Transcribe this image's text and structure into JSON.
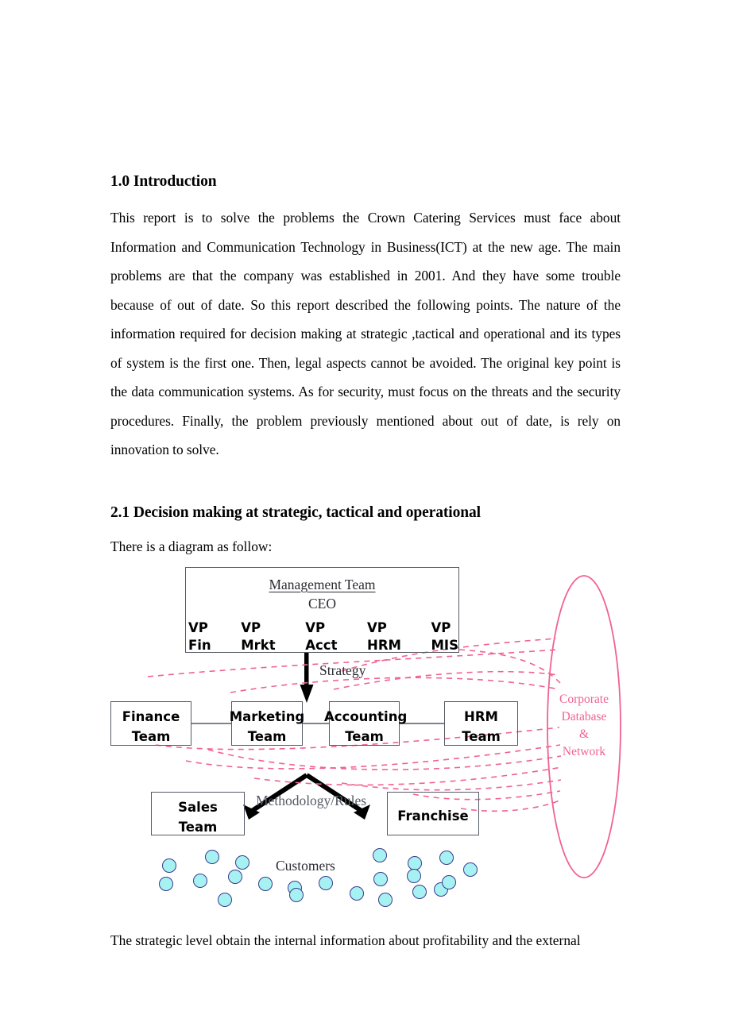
{
  "document": {
    "sections": [
      {
        "heading": "1.0 Introduction",
        "paragraph": "This report is to solve the problems the Crown Catering Services must face about Information and Communication Technology in Business(ICT) at the new age. The main problems are that the company was established in 2001. And they have some trouble because of out of date. So this report described the following points. The nature of the information required for decision making at strategic ,tactical and operational and its types of system is the first one. Then, legal aspects cannot be avoided. The original key point is the data communication systems. As for security, must focus on the threats and the security procedures. Finally, the problem previously mentioned about out of date, is rely on innovation to solve."
      },
      {
        "heading": "2.1 Decision making at strategic, tactical and operational",
        "intro": "There is a diagram as follow:",
        "closing": "The strategic level obtain the internal information about profitability and the external"
      }
    ]
  },
  "diagram": {
    "management": {
      "title": "Management Team",
      "ceo": "CEO",
      "vps": [
        {
          "line1": "VP",
          "line2": "Fin"
        },
        {
          "line1": "VP",
          "line2": "Mrkt"
        },
        {
          "line1": "VP",
          "line2": "Acct"
        },
        {
          "line1": "VP",
          "line2": "HRM"
        },
        {
          "line1": "VP",
          "line2": "MIS"
        }
      ]
    },
    "labels": {
      "strategy": "Strategy",
      "methodology": "Methodology/Rules",
      "customers": "Customers"
    },
    "teams": [
      {
        "line1": "Finance",
        "line2": "Team"
      },
      {
        "line1": "Marketing",
        "line2": "Team"
      },
      {
        "line1": "Accounting",
        "line2": "Team"
      },
      {
        "line1": "HRM",
        "line2": "Team"
      }
    ],
    "channels": [
      {
        "line1": "Sales",
        "line2": "Team"
      },
      {
        "line1": "Franchise",
        "line2": ""
      }
    ],
    "datastore": {
      "line1": "Corporate",
      "line2": "Database",
      "line3": "&",
      "line4": "Network"
    },
    "colors": {
      "box_border": "#555a66",
      "arrow": "#000000",
      "datastore": "#f06292",
      "customer_fill": "#a6f2f2",
      "customer_border": "#3b3a8f"
    },
    "customer_count": 22
  }
}
